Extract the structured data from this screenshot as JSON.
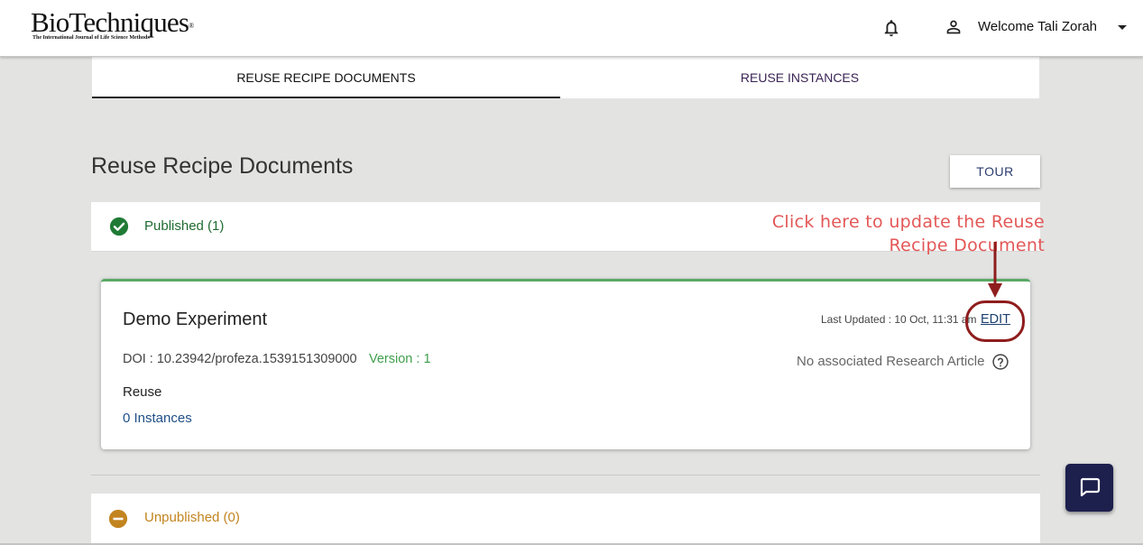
{
  "header": {
    "logo_main": "BioTechniques",
    "logo_sub": "The International Journal of Life Science Methods",
    "welcome_text": "Welcome Tali Zorah"
  },
  "tabs": [
    {
      "label": "REUSE RECIPE DOCUMENTS",
      "active": true
    },
    {
      "label": "REUSE INSTANCES",
      "active": false
    }
  ],
  "page": {
    "title": "Reuse Recipe Documents",
    "tour_label": "TOUR"
  },
  "published": {
    "label": "Published (1)"
  },
  "annotation": {
    "line1": "Click here to update the Reuse",
    "line2": "Recipe Document"
  },
  "card": {
    "title": "Demo Experiment",
    "doi": "DOI : 10.23942/profeza.1539151309000",
    "version": "Version : 1",
    "reuse_label": "Reuse",
    "instances_link": "0 Instances",
    "last_updated": "Last Updated : 10 Oct, 11:31 am",
    "edit_label": "EDIT",
    "no_article": "No associated Research Article"
  },
  "unpublished": {
    "label": "Unpublished (0)"
  },
  "colors": {
    "published_green": "#1f6b31",
    "unpublished_amber": "#c2841f",
    "annotation_red": "#e35757",
    "chat_navy": "#1d1f4d"
  },
  "icons": [
    "bell-icon",
    "user-icon",
    "caret-down-icon",
    "check-circle-icon",
    "help-icon",
    "minus-circle-icon",
    "chat-icon"
  ]
}
